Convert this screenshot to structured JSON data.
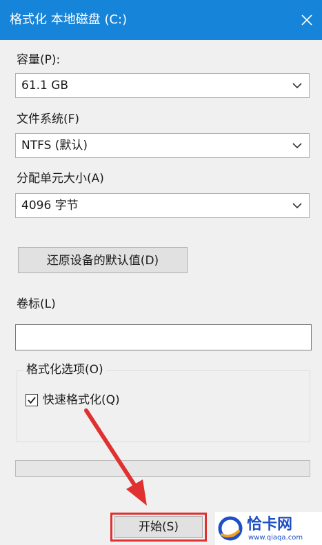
{
  "window": {
    "title": "格式化 本地磁盘 (C:)",
    "accent_color": "#1684d9",
    "close_icon": "close-icon"
  },
  "capacity": {
    "label": "容量(P):",
    "value": "61.1 GB"
  },
  "filesystem": {
    "label": "文件系统(F)",
    "value": "NTFS (默认)"
  },
  "allocation": {
    "label": "分配单元大小(A)",
    "value": "4096 字节"
  },
  "restore_button": {
    "label": "还原设备的默认值(D)"
  },
  "volume_label": {
    "label": "卷标(L)",
    "value": ""
  },
  "format_options": {
    "legend": "格式化选项(O)",
    "quick_format": {
      "label": "快速格式化(Q)",
      "checked": true
    }
  },
  "progress": {
    "value": 0
  },
  "start_button": {
    "label": "开始(S)",
    "highlight_color": "#e03030"
  },
  "annotation": {
    "arrow_color": "#e03030"
  },
  "watermark": {
    "title": "恰卡网",
    "subtitle": "www.qiaqa.com",
    "color": "#1f4fc4"
  }
}
